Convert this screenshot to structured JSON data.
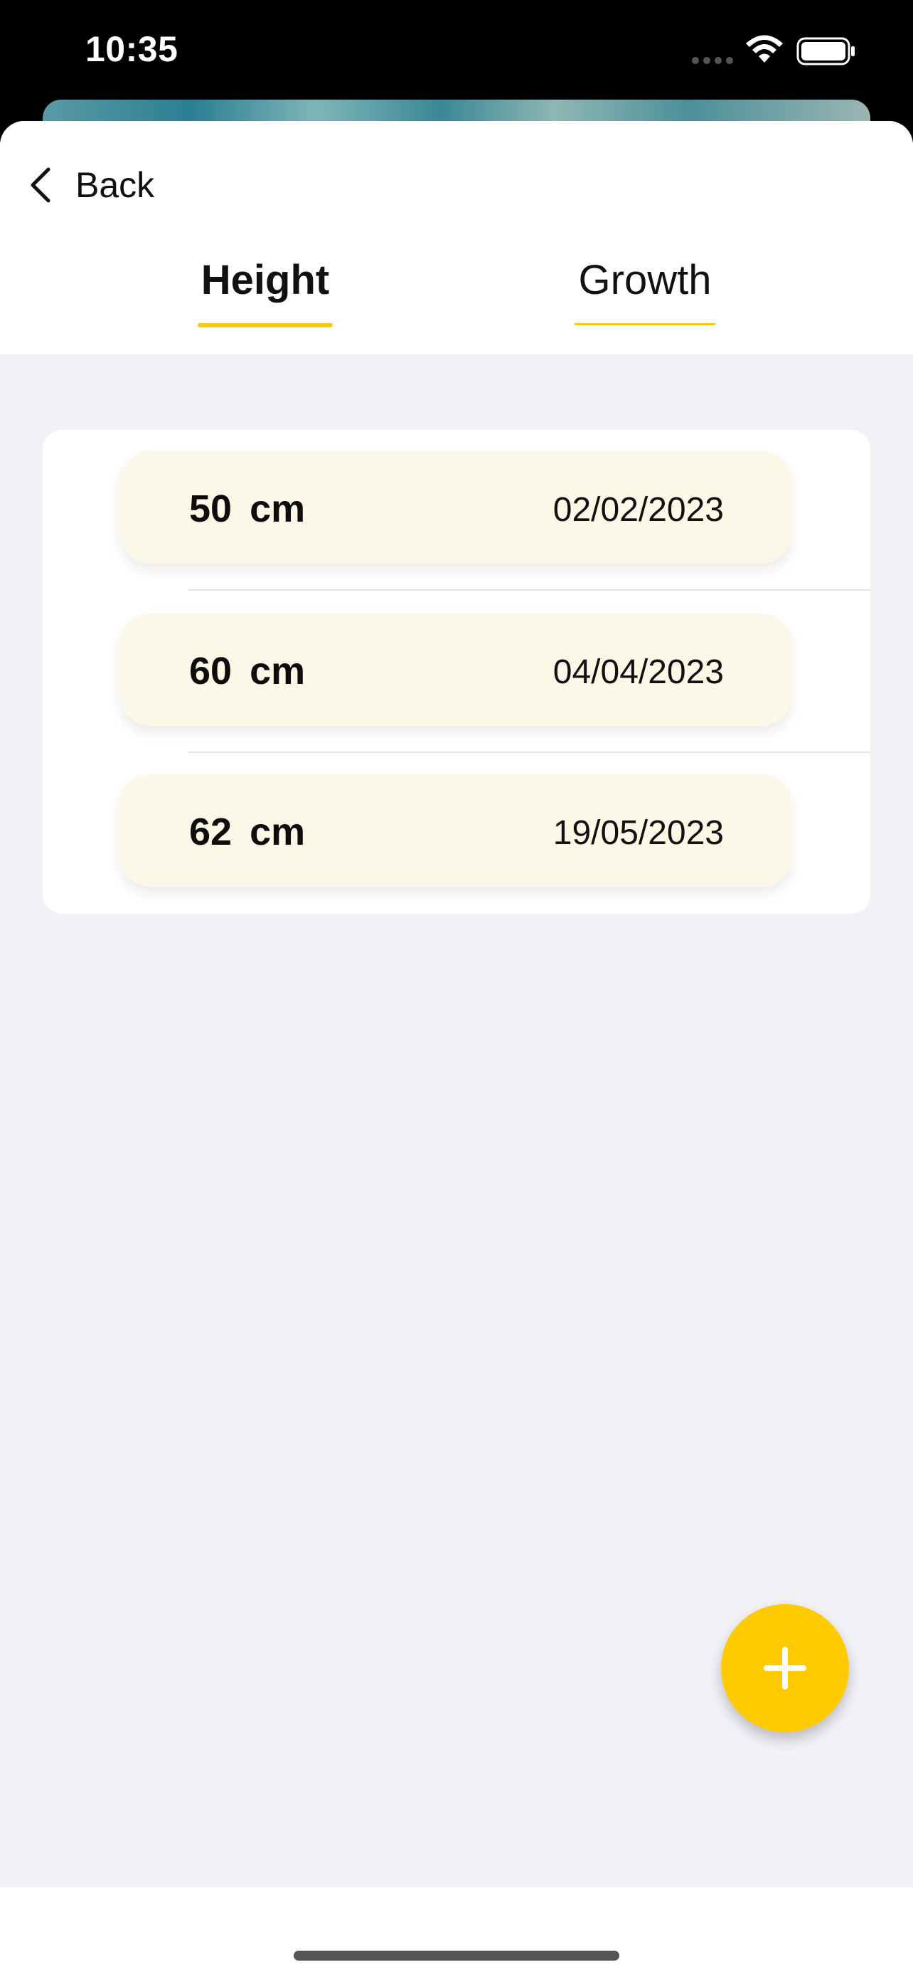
{
  "status_bar": {
    "time": "10:35",
    "icons": [
      "cellular-signal-icon",
      "wifi-icon",
      "battery-icon"
    ]
  },
  "header": {
    "back_label": "Back",
    "back_icon": "chevron-left-icon"
  },
  "tabs": [
    {
      "label": "Height",
      "active": true
    },
    {
      "label": "Growth",
      "active": false
    }
  ],
  "entries": [
    {
      "value": "50  cm",
      "date": "02/02/2023"
    },
    {
      "value": "60  cm",
      "date": "04/04/2023"
    },
    {
      "value": "62  cm",
      "date": "19/05/2023"
    }
  ],
  "fab": {
    "icon": "plus-icon"
  },
  "colors": {
    "accent": "#fdcb00",
    "tab_underline": "#f8c914",
    "entry_background": "#fcf8e7",
    "page_background": "#f1f1f6"
  }
}
